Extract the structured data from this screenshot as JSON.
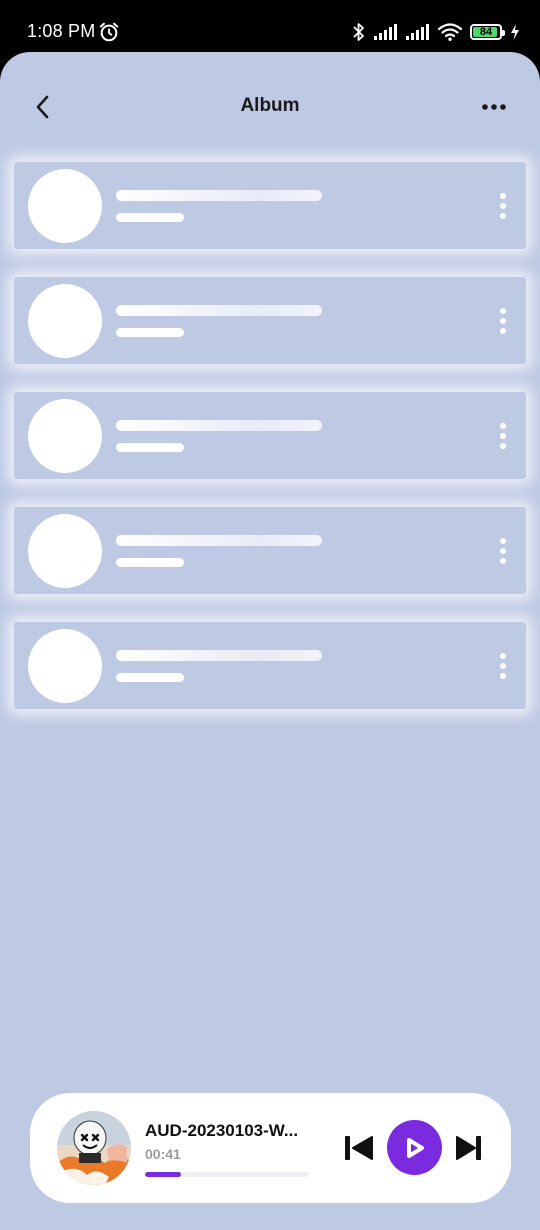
{
  "status_bar": {
    "time": "1:08 PM",
    "battery_level": "84",
    "icons": [
      "alarm-icon",
      "bluetooth-icon",
      "signal-icon",
      "signal-icon",
      "wifi-icon",
      "battery-icon",
      "charging-icon"
    ]
  },
  "header": {
    "title": "Album",
    "back_icon": "back-arrow-icon",
    "more_icon": "more-horizontal-icon"
  },
  "album_list": {
    "loading_placeholders": 5,
    "item_menu_icon": "more-vertical-icon"
  },
  "player": {
    "track_title": "AUD-20230103-W...",
    "elapsed": "00:41",
    "progress_fraction": 0.22,
    "controls": [
      "skip-previous-icon",
      "play-icon",
      "skip-next-icon"
    ]
  },
  "colors": {
    "background": "#bec9e4",
    "accent": "#7a2be0",
    "placeholder": "#ffffff"
  }
}
